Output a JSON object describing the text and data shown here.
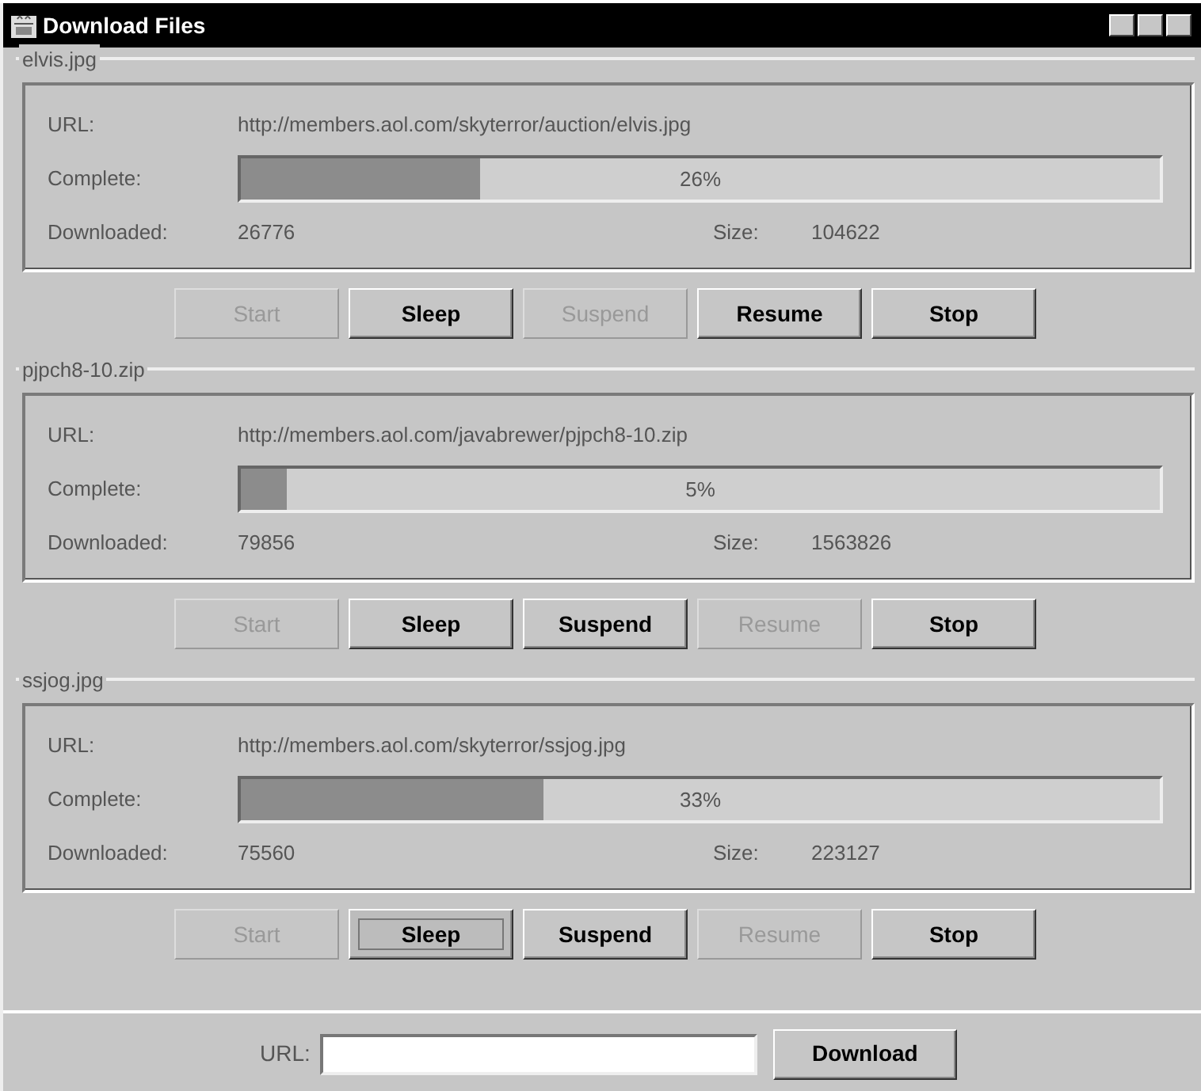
{
  "window": {
    "title": "Download Files"
  },
  "downloads": [
    {
      "name": "elvis.jpg",
      "url_label": "URL:",
      "url": "http://members.aol.com/skyterror/auction/elvis.jpg",
      "complete_label": "Complete:",
      "level": 0.26,
      "percent": "26%",
      "downloaded_label": "Downloaded:",
      "downloaded": "26776",
      "size_label": "Size:",
      "size": "104622",
      "buttons": [
        {
          "label": "Start",
          "disabled": true,
          "focused": false
        },
        {
          "label": "Sleep",
          "disabled": false,
          "focused": false
        },
        {
          "label": "Suspend",
          "disabled": true,
          "focused": false
        },
        {
          "label": "Resume",
          "disabled": false,
          "focused": false
        },
        {
          "label": "Stop",
          "disabled": false,
          "focused": false
        }
      ]
    },
    {
      "name": "pjpch8-10.zip",
      "url_label": "URL:",
      "url": "http://members.aol.com/javabrewer/pjpch8-10.zip",
      "complete_label": "Complete:",
      "level": 0.05,
      "percent": "5%",
      "downloaded_label": "Downloaded:",
      "downloaded": "79856",
      "size_label": "Size:",
      "size": "1563826",
      "buttons": [
        {
          "label": "Start",
          "disabled": true,
          "focused": false
        },
        {
          "label": "Sleep",
          "disabled": false,
          "focused": false
        },
        {
          "label": "Suspend",
          "disabled": false,
          "focused": false
        },
        {
          "label": "Resume",
          "disabled": true,
          "focused": false
        },
        {
          "label": "Stop",
          "disabled": false,
          "focused": false
        }
      ]
    },
    {
      "name": "ssjog.jpg",
      "url_label": "URL:",
      "url": "http://members.aol.com/skyterror/ssjog.jpg",
      "complete_label": "Complete:",
      "level": 0.33,
      "percent": "33%",
      "downloaded_label": "Downloaded:",
      "downloaded": "75560",
      "size_label": "Size:",
      "size": "223127",
      "buttons": [
        {
          "label": "Start",
          "disabled": true,
          "focused": false
        },
        {
          "label": "Sleep",
          "disabled": false,
          "focused": true
        },
        {
          "label": "Suspend",
          "disabled": false,
          "focused": false
        },
        {
          "label": "Resume",
          "disabled": true,
          "focused": false
        },
        {
          "label": "Stop",
          "disabled": false,
          "focused": false
        }
      ]
    }
  ],
  "footer": {
    "url_label": "URL:",
    "button": "Download"
  }
}
